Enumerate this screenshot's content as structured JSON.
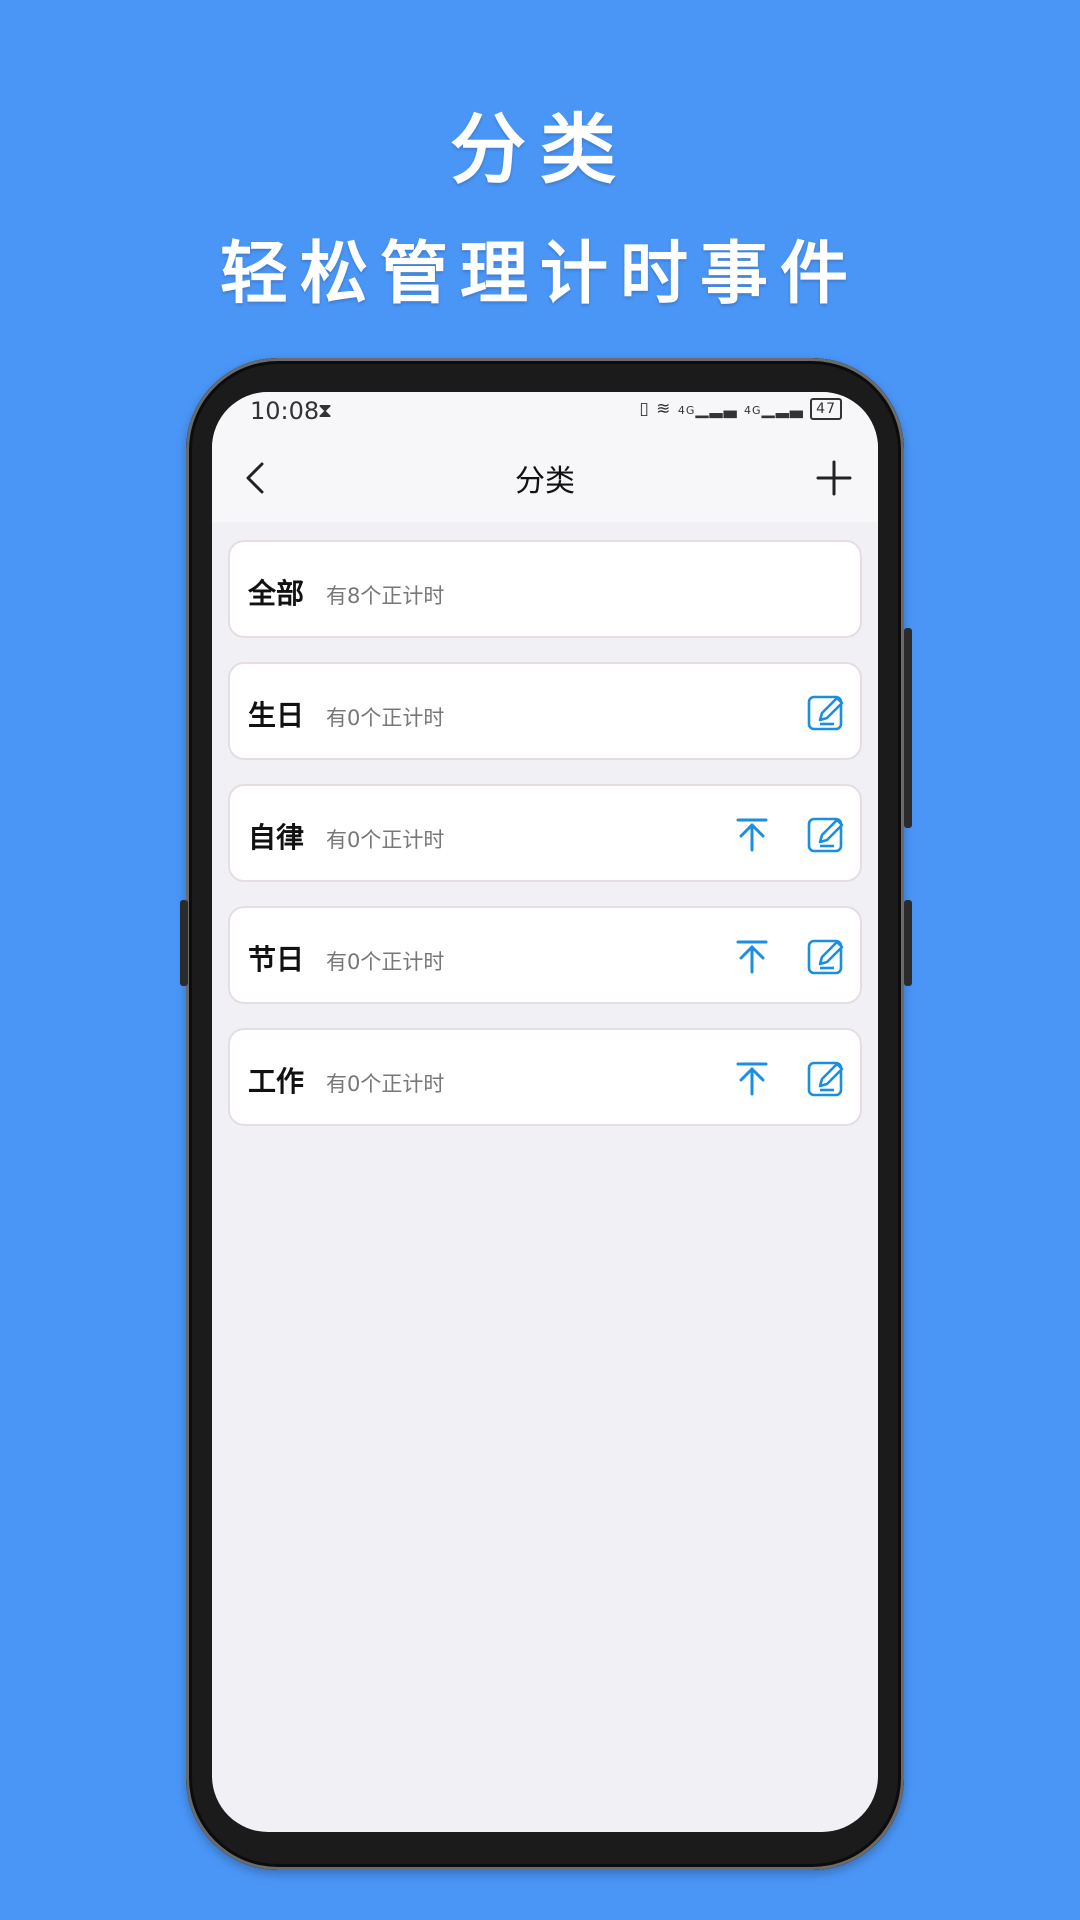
{
  "promo": {
    "title": "分类",
    "subtitle": "轻松管理计时事件"
  },
  "status_bar": {
    "time": "10:08",
    "network_label_1": "4G",
    "network_label_2": "4G",
    "battery_level": "47"
  },
  "nav": {
    "title": "分类"
  },
  "categories": [
    {
      "name": "全部",
      "count_text": "有8个正计时",
      "pinnable": false,
      "editable": false
    },
    {
      "name": "生日",
      "count_text": "有0个正计时",
      "pinnable": false,
      "editable": true
    },
    {
      "name": "自律",
      "count_text": "有0个正计时",
      "pinnable": true,
      "editable": true
    },
    {
      "name": "节日",
      "count_text": "有0个正计时",
      "pinnable": true,
      "editable": true
    },
    {
      "name": "工作",
      "count_text": "有0个正计时",
      "pinnable": true,
      "editable": true
    }
  ],
  "colors": {
    "background": "#4a96f7",
    "accent": "#1a8fe0",
    "card_border": "#e6dde3",
    "screen_bg": "#f0f0f5"
  },
  "icons": [
    "back-icon",
    "plus-icon",
    "pin-top-icon",
    "edit-icon",
    "hourglass-icon",
    "vibrate-icon",
    "wifi-icon",
    "signal-icon",
    "battery-icon"
  ]
}
